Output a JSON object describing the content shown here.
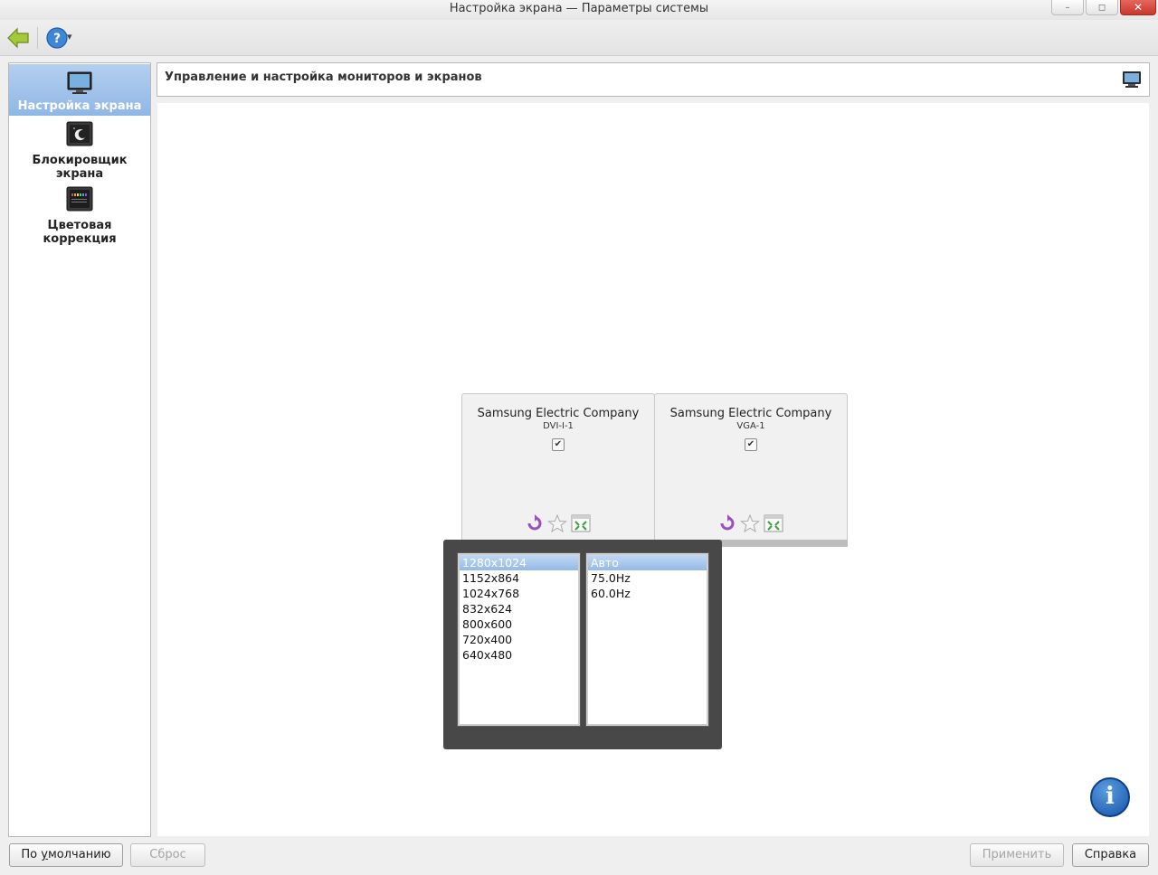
{
  "window": {
    "title": "Настройка экрана — Параметры системы",
    "buttons": {
      "minimize": "–",
      "maximize": "◻",
      "close": "✕"
    }
  },
  "toolbar": {
    "back_icon": "back-arrow-icon",
    "help_icon": "help-icon",
    "help_dropdown": "▾"
  },
  "sidebar": {
    "items": [
      {
        "label": "Настройка экрана",
        "icon": "monitor-icon",
        "selected": true
      },
      {
        "label": "Блокировщик экрана",
        "icon": "screen-locker-icon",
        "selected": false
      },
      {
        "label": "Цветовая коррекция",
        "icon": "color-correction-icon",
        "selected": false
      }
    ]
  },
  "header": {
    "title": "Управление и настройка мониторов и экранов",
    "icon": "monitor-settings-icon"
  },
  "monitors": [
    {
      "name": "Samsung Electric Company",
      "output": "DVI-I-1",
      "enabled": true
    },
    {
      "name": "Samsung Electric Company",
      "output": "VGA-1",
      "enabled": true
    }
  ],
  "resolution_popup": {
    "resolutions": [
      "1280x1024",
      "1152x864",
      "1024x768",
      "832x624",
      "800x600",
      "720x400",
      "640x480"
    ],
    "selected_resolution": "1280x1024",
    "refresh_rates": [
      "Авто",
      "75.0Hz",
      "60.0Hz"
    ],
    "selected_refresh_rate": "Авто"
  },
  "footer": {
    "defaults_label": "По умолчанию",
    "defaults_underline": "у",
    "reset_label": "Сброс",
    "apply_label": "Применить",
    "help_label": "Справка"
  },
  "colors": {
    "selection": "#8fb7e6",
    "popup_bg": "#484848",
    "info_blue": "#1654a8",
    "close_red": "#c9372c"
  }
}
